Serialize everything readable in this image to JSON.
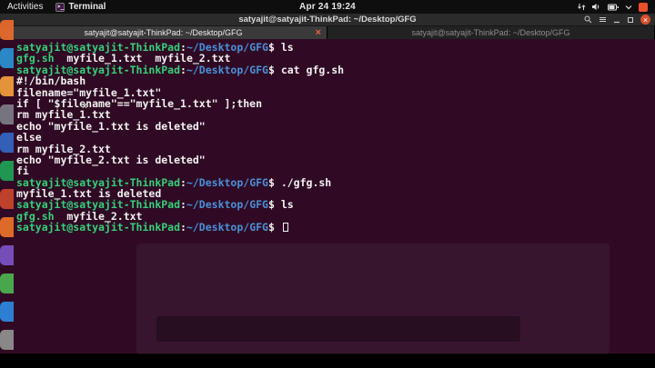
{
  "colors": {
    "terminal_bg": "#300a24",
    "prompt_green": "#33d17a",
    "path_blue": "#4a90d9",
    "terminal_white": "#f2f2f2",
    "close_orange": "#e0643c",
    "topbar_bg": "#0e0e0e"
  },
  "top_bar": {
    "activities_label": "Activities",
    "app_menu_label": "Terminal",
    "clock": "Apr 24 19:24",
    "tray_icons": [
      "network-icon",
      "volume-icon",
      "battery-icon",
      "chevron-down-icon",
      "indicator-icon"
    ]
  },
  "window": {
    "title": "satyajit@satyajit-ThinkPad: ~/Desktop/GFG",
    "titlebar_icons": [
      "search-icon",
      "menu-icon",
      "minimize-icon",
      "maximize-icon",
      "close-icon"
    ],
    "tabs": [
      {
        "label": "satyajit@satyajit-ThinkPad: ~/Desktop/GFG",
        "active": true,
        "closable": true
      },
      {
        "label": "satyajit@satyajit-ThinkPad: ~/Desktop/GFG",
        "active": false,
        "closable": false
      }
    ],
    "tab_close_glyph": "×"
  },
  "terminal": {
    "lines": [
      {
        "segs": [
          {
            "t": "satyajit@satyajit-ThinkPad",
            "c": "green"
          },
          {
            "t": ":",
            "c": "white"
          },
          {
            "t": "~/Desktop/GFG",
            "c": "blue"
          },
          {
            "t": "$ ",
            "c": "white"
          },
          {
            "t": "ls",
            "c": "white"
          }
        ]
      },
      {
        "segs": [
          {
            "t": "gfg.sh",
            "c": "green"
          },
          {
            "t": "  myfile_1.txt  myfile_2.txt",
            "c": "white"
          }
        ]
      },
      {
        "segs": [
          {
            "t": "satyajit@satyajit-ThinkPad",
            "c": "green"
          },
          {
            "t": ":",
            "c": "white"
          },
          {
            "t": "~/Desktop/GFG",
            "c": "blue"
          },
          {
            "t": "$ ",
            "c": "white"
          },
          {
            "t": "cat gfg.sh",
            "c": "white"
          }
        ]
      },
      {
        "segs": [
          {
            "t": "#!/bin/bash",
            "c": "white"
          }
        ]
      },
      {
        "segs": [
          {
            "t": "filename=\"myfile_1.txt\"",
            "c": "white"
          }
        ]
      },
      {
        "segs": [
          {
            "t": "if [ \"$filename\"==\"myfile_1.txt\" ];then",
            "c": "white"
          }
        ]
      },
      {
        "segs": [
          {
            "t": "rm myfile_1.txt",
            "c": "white"
          }
        ]
      },
      {
        "segs": [
          {
            "t": "echo \"myfile_1.txt is deleted\"",
            "c": "white"
          }
        ]
      },
      {
        "segs": [
          {
            "t": "else",
            "c": "white"
          }
        ]
      },
      {
        "segs": [
          {
            "t": "rm myfile_2.txt",
            "c": "white"
          }
        ]
      },
      {
        "segs": [
          {
            "t": "echo \"myfile_2.txt is deleted\"",
            "c": "white"
          }
        ]
      },
      {
        "segs": [
          {
            "t": "fi",
            "c": "white"
          }
        ]
      },
      {
        "segs": [
          {
            "t": "satyajit@satyajit-ThinkPad",
            "c": "green"
          },
          {
            "t": ":",
            "c": "white"
          },
          {
            "t": "~/Desktop/GFG",
            "c": "blue"
          },
          {
            "t": "$ ",
            "c": "white"
          },
          {
            "t": "./gfg.sh",
            "c": "white"
          }
        ]
      },
      {
        "segs": [
          {
            "t": "myfile_1.txt is deleted",
            "c": "white"
          }
        ]
      },
      {
        "segs": [
          {
            "t": "satyajit@satyajit-ThinkPad",
            "c": "green"
          },
          {
            "t": ":",
            "c": "white"
          },
          {
            "t": "~/Desktop/GFG",
            "c": "blue"
          },
          {
            "t": "$ ",
            "c": "white"
          },
          {
            "t": "ls",
            "c": "white"
          }
        ]
      },
      {
        "segs": [
          {
            "t": "gfg.sh",
            "c": "green"
          },
          {
            "t": "  myfile_2.txt",
            "c": "white"
          }
        ]
      },
      {
        "segs": [
          {
            "t": "satyajit@satyajit-ThinkPad",
            "c": "green"
          },
          {
            "t": ":",
            "c": "white"
          },
          {
            "t": "~/Desktop/GFG",
            "c": "blue"
          },
          {
            "t": "$ ",
            "c": "white"
          }
        ],
        "cursor": true
      }
    ]
  },
  "dock": {
    "items": [
      {
        "name": "firefox",
        "color": "#e66a2c"
      },
      {
        "name": "thunderbird",
        "color": "#2a8fd0"
      },
      {
        "name": "files",
        "color": "#ef9b3c"
      },
      {
        "name": "rhythmbox",
        "color": "#7a7a85"
      },
      {
        "name": "libreoffice-writer",
        "color": "#3465c0"
      },
      {
        "name": "libreoffice-calc",
        "color": "#1f9e54"
      },
      {
        "name": "libreoffice-impress",
        "color": "#c6452c"
      },
      {
        "name": "ubuntu-software",
        "color": "#e8702a"
      },
      {
        "name": "help",
        "color": "#7a51c2"
      },
      {
        "name": "app-green",
        "color": "#4caf50"
      },
      {
        "name": "app-blue",
        "color": "#2e86de"
      },
      {
        "name": "trash",
        "color": "#8e8e8e"
      }
    ]
  },
  "mouse_cursor_glyph": "×"
}
